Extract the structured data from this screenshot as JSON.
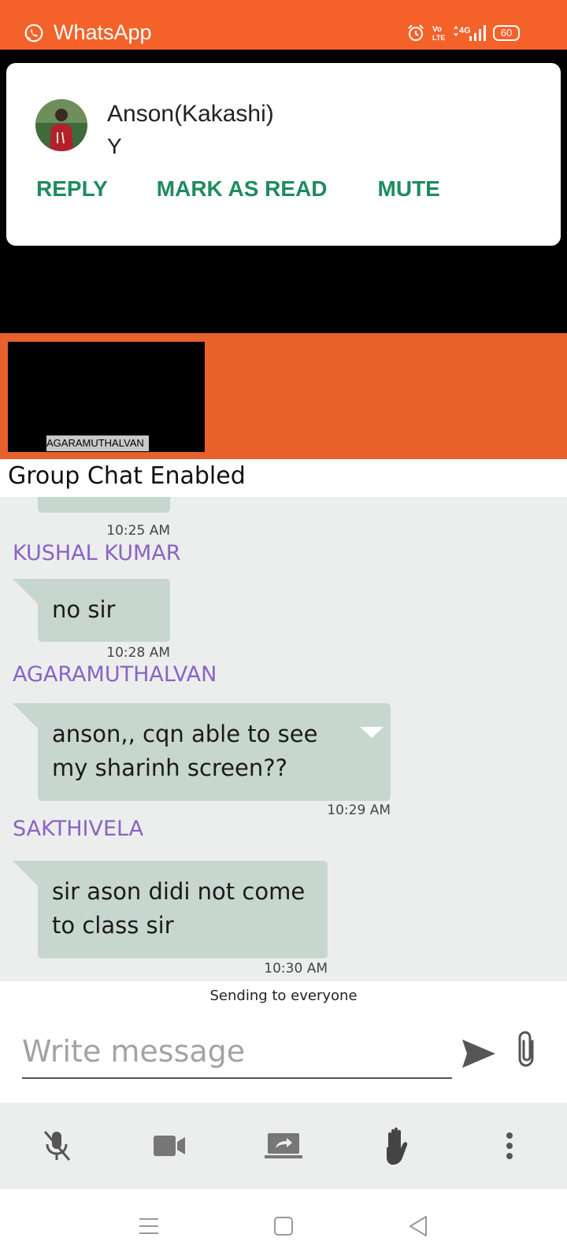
{
  "status_bar": {
    "app_name": "WhatsApp",
    "network": "4G",
    "volte": "Vo LTE",
    "battery": "60",
    "icons": [
      "whatsapp-icon",
      "alarm-icon",
      "volte-icon",
      "signal-icon",
      "battery-icon"
    ]
  },
  "notification": {
    "sender": "Anson(Kakashi)",
    "message": "Y",
    "actions": {
      "reply": "REPLY",
      "mark_read": "MARK AS READ",
      "mute": "MUTE"
    },
    "action_color": "#1f8b5f"
  },
  "video": {
    "tile_label": "AGARAMUTHALVAN"
  },
  "chat": {
    "title": "Group Chat Enabled",
    "partial_time": "10:25 AM",
    "messages": [
      {
        "sender": "KUSHAL KUMAR",
        "lines": [
          "no sir"
        ],
        "time": "10:28 AM"
      },
      {
        "sender": "AGARAMUTHALVAN",
        "lines": [
          "anson,, cqn able to see",
          "my sharinh screen??"
        ],
        "time": "10:29 AM"
      },
      {
        "sender": "SAKTHIVELA",
        "lines": [
          "sir ason didi not come",
          "to class sir"
        ],
        "time": "10:30 AM"
      }
    ],
    "sender_color": "#8a63c4",
    "bubble_color": "#c8d6d0"
  },
  "compose": {
    "status": "Sending to everyone",
    "placeholder": "Write message",
    "icons": [
      "send-icon",
      "attach-icon"
    ]
  },
  "toolbar": {
    "icons": [
      "mic-off-icon",
      "video-camera-icon",
      "screen-share-icon",
      "raise-hand-icon",
      "more-vert-icon"
    ]
  },
  "navigation": {
    "icons": [
      "menu-icon",
      "home-icon",
      "back-icon"
    ]
  },
  "colors": {
    "brand_orange": "#f4622a",
    "chat_background": "#eceeed"
  }
}
